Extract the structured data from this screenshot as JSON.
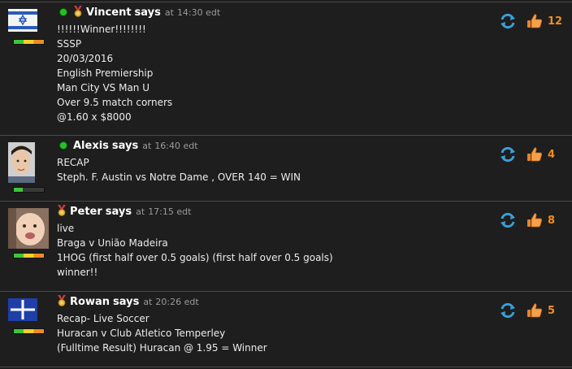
{
  "colors": {
    "accent_orange": "#f08d1e",
    "online_green": "#26c026",
    "refresh_blue": "#3aa0d8"
  },
  "comments": [
    {
      "author": "Vincent",
      "says": "says",
      "at": "at",
      "time": "14:30 edt",
      "online": true,
      "medal": true,
      "avatar": "israel-flag-avatar",
      "rank": "orange",
      "lines": [
        "!!!!!!Winner!!!!!!!!",
        "SSSP",
        "20/03/2016",
        "English Premiership",
        "Man City VS Man U",
        "Over 9.5 match corners",
        "@1.60 x $8000"
      ],
      "likes": "12"
    },
    {
      "author": "Alexis",
      "says": "says",
      "at": "at",
      "time": "16:40 edt",
      "online": true,
      "medal": false,
      "avatar": "alexis-photo-avatar",
      "rank": "green",
      "lines": [
        "RECAP",
        "Steph. F. Austin vs Notre Dame , OVER 140 = WIN"
      ],
      "likes": "4"
    },
    {
      "author": "Peter",
      "says": "says",
      "at": "at",
      "time": "17:15 edt",
      "online": false,
      "medal": true,
      "avatar": "baby-photo-avatar",
      "rank": "orange",
      "lines": [
        "live",
        "Braga v União Madeira",
        "1HOG (first half over 0.5 goals) (first half over 0.5 goals)",
        "winner!!"
      ],
      "likes": "8"
    },
    {
      "author": "Rowan",
      "says": "says",
      "at": "at",
      "time": "20:26 edt",
      "online": false,
      "medal": true,
      "avatar": "eureka-flag-avatar",
      "rank": "orange",
      "lines": [
        "Recap- Live Soccer",
        "Huracan v Club Atletico Temperley",
        "(Fulltime Result) Huracan @ 1.95 = Winner"
      ],
      "likes": "5"
    }
  ]
}
